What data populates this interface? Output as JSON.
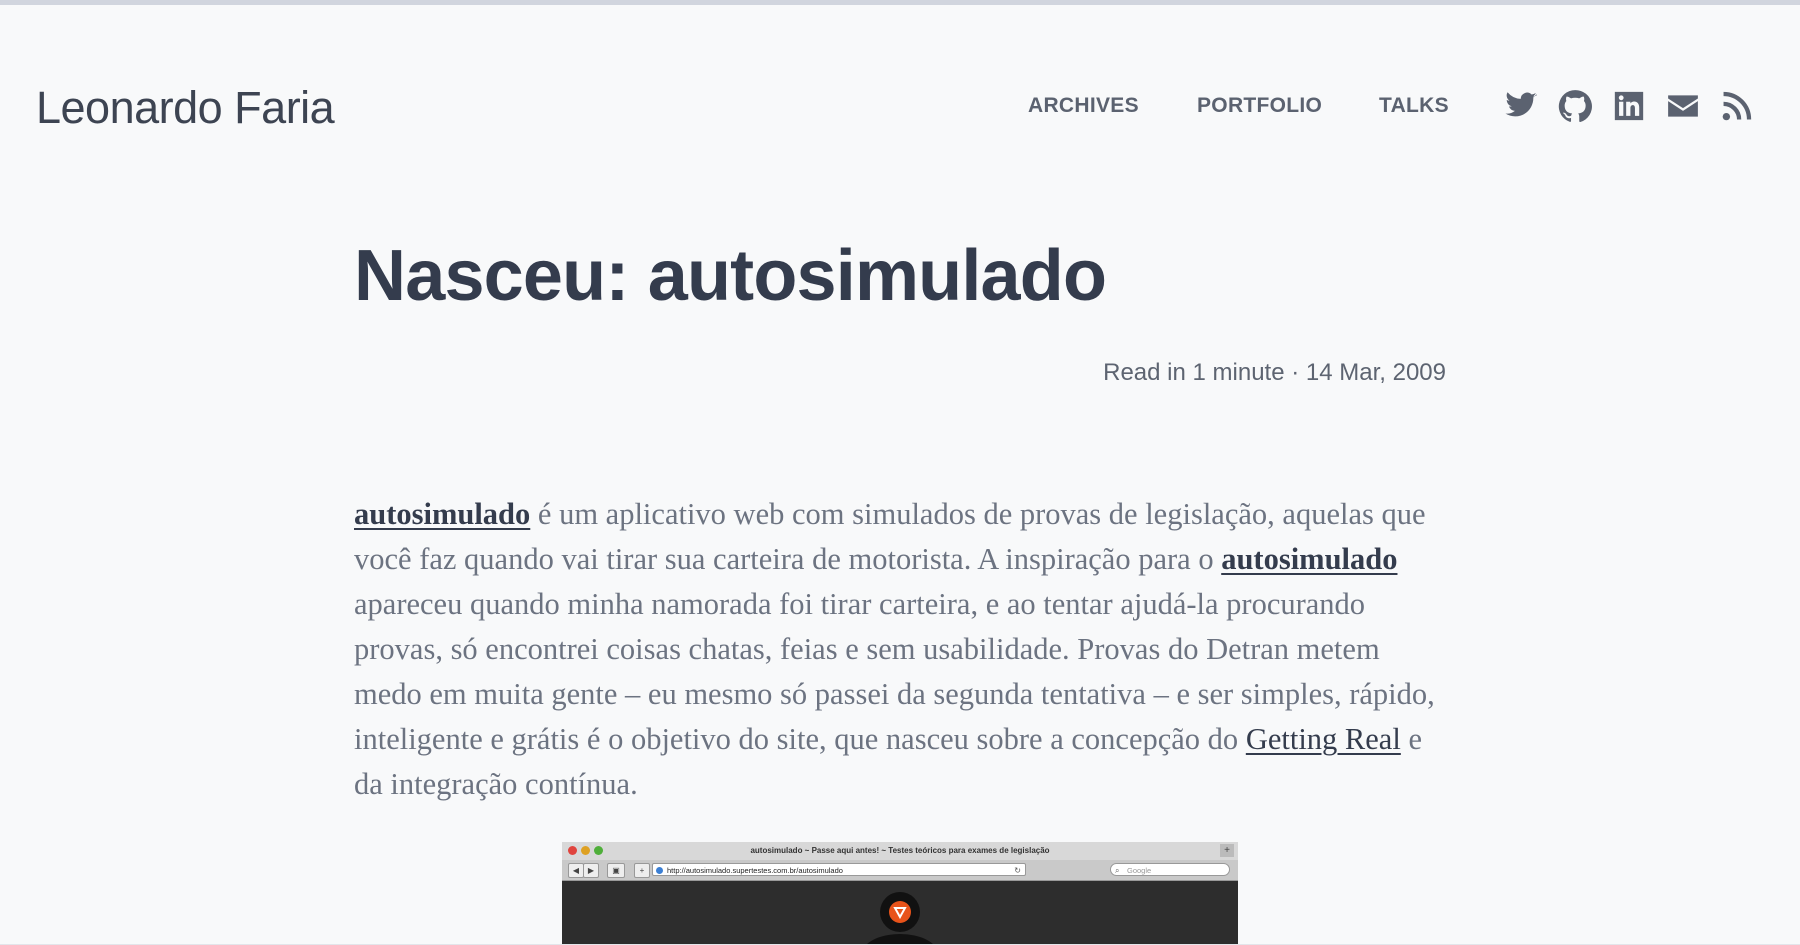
{
  "site": {
    "brand": "Leonardo Faria",
    "nav": [
      {
        "label": "ARCHIVES"
      },
      {
        "label": "PORTFOLIO"
      },
      {
        "label": "TALKS"
      }
    ],
    "social_icons": [
      "twitter-icon",
      "github-icon",
      "linkedin-icon",
      "mail-icon",
      "rss-icon"
    ]
  },
  "post": {
    "title": "Nasceu: autosimulado",
    "meta": "Read in 1 minute · 14 Mar, 2009",
    "body": {
      "link_1": "autosimulado",
      "text_1": " é um aplicativo web com simulados de provas de legislação, aquelas que você faz quando vai tirar sua carteira de motorista. A inspiração para o ",
      "link_2": "autosimulado",
      "text_2": " apareceu quando minha namorada foi tirar carteira, e ao tentar ajudá-la procurando provas, só encontrei coisas chatas, feias e sem usabilidade. Provas do Detran metem medo em muita gente – eu mesmo só passei da segunda tentativa – e ser simples, rápido, inteligente e grátis é o objetivo do site, que nasceu sobre a concepção do ",
      "link_3": "Getting Real",
      "text_3": " e da integração contínua."
    },
    "screenshot": {
      "window_title": "autosimulado ~ Passe aqui antes! ~ Testes teóricos para exames de legislação",
      "url": "http://autosimulado.supertestes.com.br/autosimulado",
      "search_placeholder": "Google"
    }
  },
  "colors": {
    "background": "#f8f9fa",
    "heading": "#343c4d",
    "body_text": "#6c7381",
    "nav_text": "#5b6270",
    "logo_orange": "#e8531a"
  }
}
